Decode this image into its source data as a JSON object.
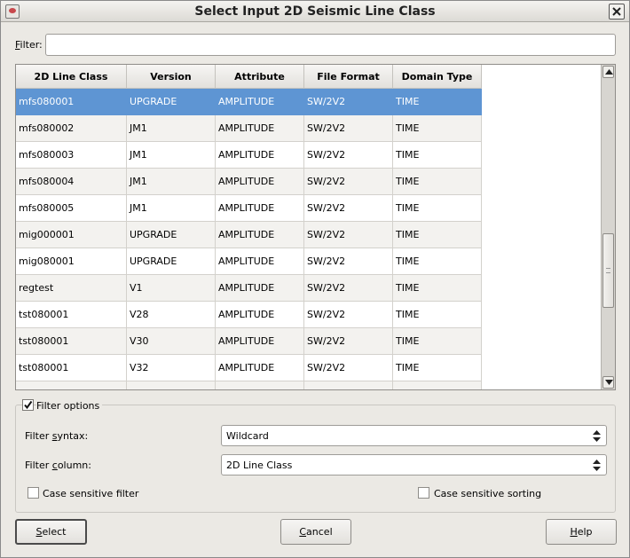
{
  "window": {
    "title": "Select Input 2D Seismic Line Class"
  },
  "filter": {
    "label_mnemonic": "F",
    "label_rest": "ilter:",
    "value": ""
  },
  "table": {
    "columns": [
      "2D Line Class",
      "Version",
      "Attribute",
      "File Format",
      "Domain Type"
    ],
    "rows": [
      [
        "mfs080001",
        "UPGRADE",
        "AMPLITUDE",
        "SW/2V2",
        "TIME"
      ],
      [
        "mfs080002",
        "JM1",
        "AMPLITUDE",
        "SW/2V2",
        "TIME"
      ],
      [
        "mfs080003",
        "JM1",
        "AMPLITUDE",
        "SW/2V2",
        "TIME"
      ],
      [
        "mfs080004",
        "JM1",
        "AMPLITUDE",
        "SW/2V2",
        "TIME"
      ],
      [
        "mfs080005",
        "JM1",
        "AMPLITUDE",
        "SW/2V2",
        "TIME"
      ],
      [
        "mig000001",
        "UPGRADE",
        "AMPLITUDE",
        "SW/2V2",
        "TIME"
      ],
      [
        "mig080001",
        "UPGRADE",
        "AMPLITUDE",
        "SW/2V2",
        "TIME"
      ],
      [
        "regtest",
        "V1",
        "AMPLITUDE",
        "SW/2V2",
        "TIME"
      ],
      [
        "tst080001",
        "V28",
        "AMPLITUDE",
        "SW/2V2",
        "TIME"
      ],
      [
        "tst080001",
        "V30",
        "AMPLITUDE",
        "SW/2V2",
        "TIME"
      ],
      [
        "tst080001",
        "V32",
        "AMPLITUDE",
        "SW/2V2",
        "TIME"
      ],
      [
        "",
        "",
        "",
        "",
        ""
      ]
    ],
    "selected_row": 0
  },
  "filter_options": {
    "label": "Filter options",
    "checked": true,
    "syntax_label_pre": "Filter ",
    "syntax_label_mn": "s",
    "syntax_label_post": "yntax:",
    "syntax_value": "Wildcard",
    "column_label_pre": "Filter ",
    "column_label_mn": "c",
    "column_label_post": "olumn:",
    "column_value": "2D Line Class",
    "case_filter_label": "Case sensitive filter",
    "case_sort_label": "Case sensitive sorting"
  },
  "buttons": {
    "select_mn": "S",
    "select_rest": "elect",
    "cancel_mn": "C",
    "cancel_rest": "ancel",
    "help_mn": "H",
    "help_rest": "elp"
  }
}
